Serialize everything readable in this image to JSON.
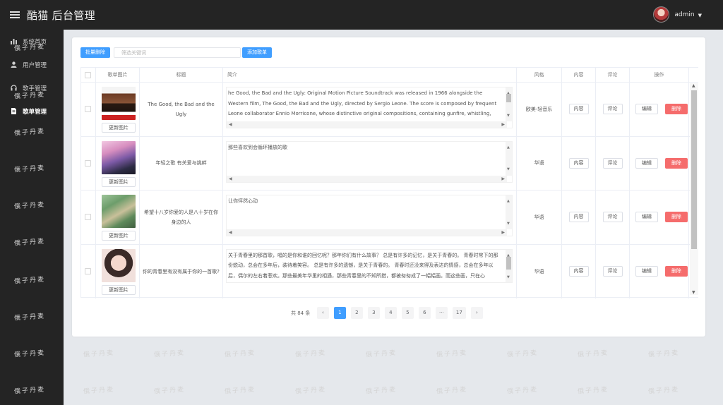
{
  "app": {
    "title": "酷猫 后台管理"
  },
  "user": {
    "name": "admin"
  },
  "sidebar": {
    "items": [
      {
        "label": "系统首页",
        "icon": "bar-chart-icon"
      },
      {
        "label": "用户管理",
        "icon": "user-icon"
      },
      {
        "label": "歌手管理",
        "icon": "headphones-icon"
      },
      {
        "label": "歌单管理",
        "icon": "document-icon",
        "active": true
      }
    ]
  },
  "toolbar": {
    "batch_delete": "批量删除",
    "search_placeholder": "筛选关键词",
    "add_playlist": "添加歌单"
  },
  "table": {
    "headers": {
      "image": "歌单图片",
      "title": "标题",
      "intro": "简介",
      "style": "风格",
      "content": "内容",
      "comment": "评论",
      "ops": "操作"
    },
    "update_image_label": "更新图片",
    "content_btn": "内容",
    "comment_btn": "评论",
    "edit_btn": "编辑",
    "delete_btn": "删除",
    "rows": [
      {
        "title": "The Good, the Bad and the Ugly",
        "intro": "he Good, the Bad and the Ugly: Original Motion Picture Soundtrack was released in 1966 alongside the Western film, The Good, the Bad and the Ugly, directed by Sergio Leone. The score is composed by frequent Leone collaborator Ennio Morricone, whose distinctive original compositions, containing gunfire, whistling, and yodeling permeate the film. The main theme, resembling the howling of a coyote, is a two-note melody that is a frequent motif, and is used for the three main characters.",
        "style": "欧美-轻音乐"
      },
      {
        "title": "年轻之歌 有关爱与挑衅",
        "intro": "那些喜欢到会循环播放的歌",
        "style": "华语"
      },
      {
        "title": "希望十八岁你爱的人是八十岁在你身边的人",
        "intro": "让你怦然心动",
        "style": "华语"
      },
      {
        "title": "你的青春里有没有属于你的一首歌?",
        "intro": "关于青春里的那首歌，唱的是你和谁的回忆呢？那年你们有什么故事？ 总是有许多的记忆，是关于青春的。 青春时常下的那份蜕动，总会在多年后，装待着笑容。 总是有许多的遗憾，是关于青春的。 青春时还没来得及表达的情感，总会在多年以后，偶尔的左右着悲欢。那些最美年华里的相遇，那些青春里的不知所措，都被匆匆成了一幅幅画。而这些画，只在心",
        "style": "华语"
      }
    ]
  },
  "pagination": {
    "total": "共 84 条",
    "prev": "‹",
    "next": "›",
    "pages": [
      "1",
      "2",
      "3",
      "4",
      "5",
      "6",
      "···",
      "17"
    ],
    "current": "1"
  },
  "watermark": "俄子丹麦",
  "colors": {
    "primary": "#409eff",
    "danger": "#f56c6c",
    "sidebar": "#242424"
  }
}
